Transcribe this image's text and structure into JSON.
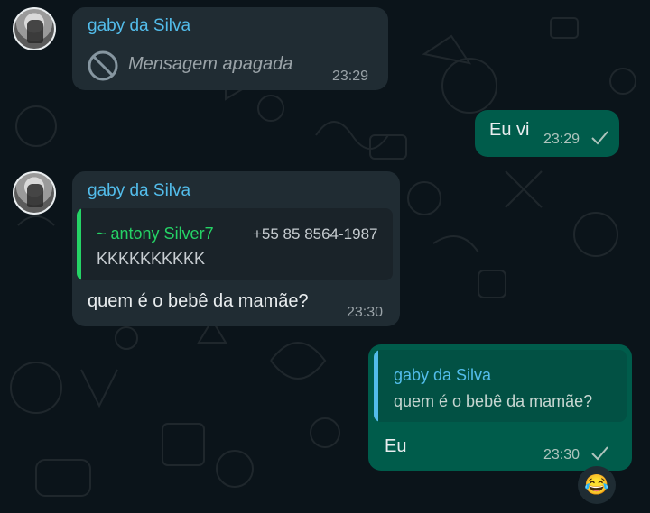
{
  "messages": [
    {
      "sender": "gaby da Silva",
      "text": "Mensagem apagada",
      "time": "23:29"
    },
    {
      "text": "Eu vi",
      "time": "23:29"
    },
    {
      "sender": "gaby da Silva",
      "quote": {
        "name": "~ antony Silver7",
        "phone": "+55 85 8564-1987",
        "text": "KKKKKKKKKK"
      },
      "text": "quem é o bebê da mamãe?",
      "time": "23:30"
    },
    {
      "quote": {
        "name": "gaby da Silva",
        "text": "quem é o bebê da mamãe?"
      },
      "text": "Eu",
      "time": "23:30",
      "reaction": "😂"
    }
  ],
  "colors": {
    "background": "#0b141a",
    "incoming_bubble": "#202c33",
    "outgoing_bubble": "#005c4b",
    "sender_name": "#53bdeb",
    "quote_bar_green": "#25d366",
    "quote_bar_blue": "#53bdeb"
  },
  "icons": {
    "deleted": "prohibited-icon",
    "sent": "single-check-icon"
  }
}
